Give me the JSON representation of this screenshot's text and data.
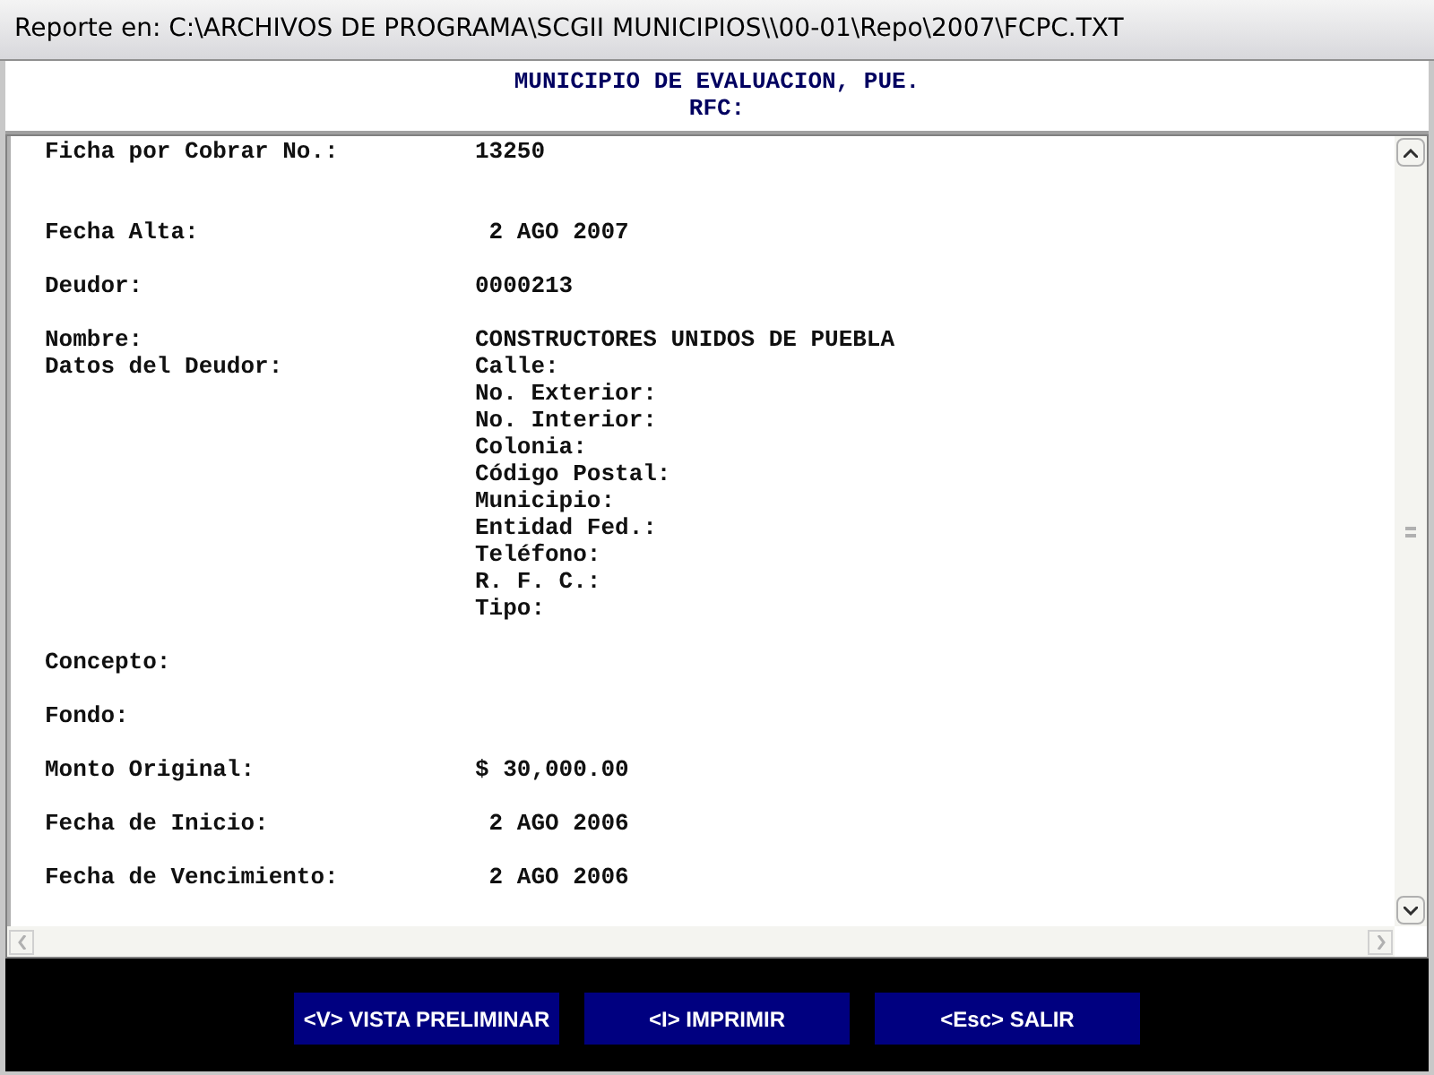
{
  "window": {
    "title": "Reporte en: C:\\ARCHIVOS DE PROGRAMA\\SCGII MUNICIPIOS\\\\00-01\\Repo\\2007\\FCPC.TXT"
  },
  "header": [
    "MUNICIPIO DE EVALUACION, PUE.",
    "RFC:"
  ],
  "report_lines": [
    {
      "kind": "field",
      "label": "Ficha por Cobrar No.:",
      "value": "13250"
    },
    {
      "kind": "blank"
    },
    {
      "kind": "blank"
    },
    {
      "kind": "field",
      "label": "Fecha Alta:",
      "value": " 2 AGO 2007"
    },
    {
      "kind": "blank"
    },
    {
      "kind": "field",
      "label": "Deudor:",
      "value": "0000213"
    },
    {
      "kind": "blank"
    },
    {
      "kind": "field",
      "label": "Nombre:",
      "value": "CONSTRUCTORES UNIDOS DE PUEBLA"
    },
    {
      "kind": "field",
      "label": "Datos del Deudor:",
      "value": "Calle:"
    },
    {
      "kind": "value",
      "value": "No. Exterior:"
    },
    {
      "kind": "value",
      "value": "No. Interior:"
    },
    {
      "kind": "value",
      "value": "Colonia:"
    },
    {
      "kind": "value",
      "value": "Código Postal:"
    },
    {
      "kind": "value",
      "value": "Municipio:"
    },
    {
      "kind": "value",
      "value": "Entidad Fed.:"
    },
    {
      "kind": "value",
      "value": "Teléfono:"
    },
    {
      "kind": "value",
      "value": "R. F. C.:"
    },
    {
      "kind": "value",
      "value": "Tipo:"
    },
    {
      "kind": "blank"
    },
    {
      "kind": "label",
      "label": "Concepto:"
    },
    {
      "kind": "blank"
    },
    {
      "kind": "label",
      "label": "Fondo:"
    },
    {
      "kind": "blank"
    },
    {
      "kind": "field",
      "label": "Monto Original:",
      "value": "$ 30,000.00"
    },
    {
      "kind": "blank"
    },
    {
      "kind": "field",
      "label": "Fecha de Inicio:",
      "value": " 2 AGO 2006"
    },
    {
      "kind": "blank"
    },
    {
      "kind": "field",
      "label": "Fecha de Vencimiento:",
      "value": " 2 AGO 2006"
    }
  ],
  "buttons": [
    "<V> VISTA PRELIMINAR",
    "<I> IMPRIMIR",
    "<Esc> SALIR"
  ]
}
